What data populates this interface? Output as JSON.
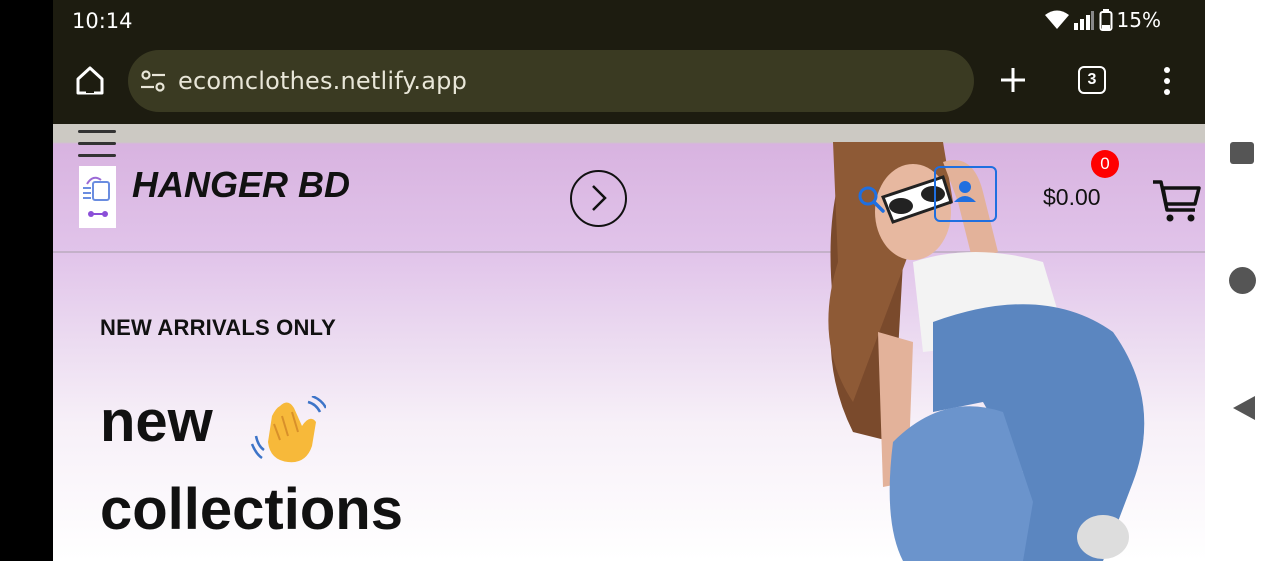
{
  "status_bar": {
    "time": "10:14",
    "battery": "15%"
  },
  "browser": {
    "url": "ecomclothes.netlify.app",
    "tab_count": "3"
  },
  "site": {
    "brand": "HANGER BD",
    "cart": {
      "badge": "0",
      "total": "$0.00"
    }
  },
  "hero": {
    "eyebrow": "NEW ARRIVALS ONLY",
    "headline_line1": "new",
    "headline_line2": "collections"
  },
  "icons": {
    "home": "home-icon",
    "tune": "tune-icon",
    "plus": "plus-icon",
    "tabs": "tabs-icon",
    "menu": "more-vert-icon",
    "hamburger": "hamburger-icon",
    "next": "chevron-right-icon",
    "search": "search-icon",
    "user": "user-icon",
    "cart": "cart-icon",
    "wave": "waving-hand-icon",
    "nav_recent": "recent-apps-icon",
    "nav_home": "home-circle-icon",
    "nav_back": "back-icon"
  },
  "colors": {
    "chrome_bg": "#1d1c10",
    "accent_blue": "#1f6fe0",
    "badge_red": "#ff0000",
    "page_lilac": "#d8b3e0"
  }
}
